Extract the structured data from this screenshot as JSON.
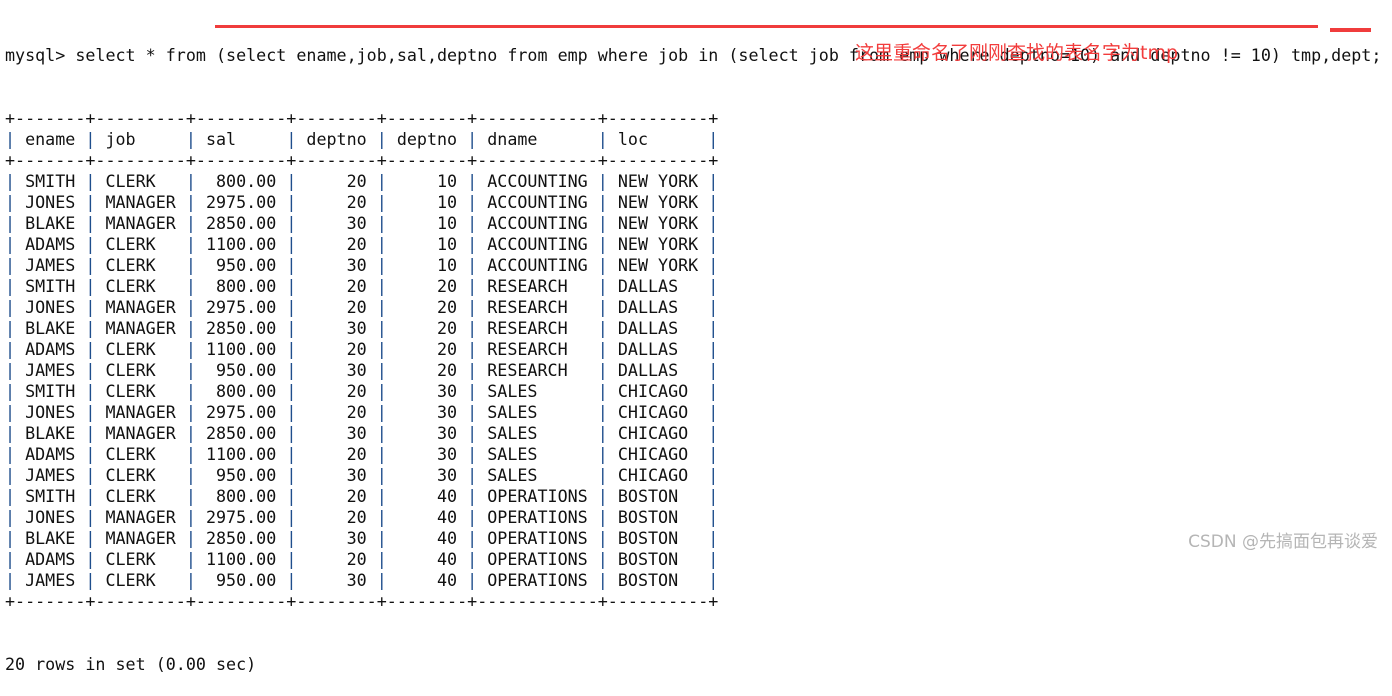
{
  "prompt": "mysql> ",
  "command": "select * from (select ename,job,sal,deptno from emp where job in (select job from emp where deptno=10) and deptno != 10) tmp,dept;",
  "annotation": "这里重命名了刚刚查找的表名字为tmp",
  "annotation_color": "#f23c3c",
  "table": {
    "columns": [
      "ename",
      "job",
      "sal",
      "deptno",
      "deptno",
      "dname",
      "loc"
    ],
    "rows": [
      [
        "SMITH",
        "CLERK",
        "800.00",
        "20",
        "10",
        "ACCOUNTING",
        "NEW YORK"
      ],
      [
        "JONES",
        "MANAGER",
        "2975.00",
        "20",
        "10",
        "ACCOUNTING",
        "NEW YORK"
      ],
      [
        "BLAKE",
        "MANAGER",
        "2850.00",
        "30",
        "10",
        "ACCOUNTING",
        "NEW YORK"
      ],
      [
        "ADAMS",
        "CLERK",
        "1100.00",
        "20",
        "10",
        "ACCOUNTING",
        "NEW YORK"
      ],
      [
        "JAMES",
        "CLERK",
        "950.00",
        "30",
        "10",
        "ACCOUNTING",
        "NEW YORK"
      ],
      [
        "SMITH",
        "CLERK",
        "800.00",
        "20",
        "20",
        "RESEARCH",
        "DALLAS"
      ],
      [
        "JONES",
        "MANAGER",
        "2975.00",
        "20",
        "20",
        "RESEARCH",
        "DALLAS"
      ],
      [
        "BLAKE",
        "MANAGER",
        "2850.00",
        "30",
        "20",
        "RESEARCH",
        "DALLAS"
      ],
      [
        "ADAMS",
        "CLERK",
        "1100.00",
        "20",
        "20",
        "RESEARCH",
        "DALLAS"
      ],
      [
        "JAMES",
        "CLERK",
        "950.00",
        "30",
        "20",
        "RESEARCH",
        "DALLAS"
      ],
      [
        "SMITH",
        "CLERK",
        "800.00",
        "20",
        "30",
        "SALES",
        "CHICAGO"
      ],
      [
        "JONES",
        "MANAGER",
        "2975.00",
        "20",
        "30",
        "SALES",
        "CHICAGO"
      ],
      [
        "BLAKE",
        "MANAGER",
        "2850.00",
        "30",
        "30",
        "SALES",
        "CHICAGO"
      ],
      [
        "ADAMS",
        "CLERK",
        "1100.00",
        "20",
        "30",
        "SALES",
        "CHICAGO"
      ],
      [
        "JAMES",
        "CLERK",
        "950.00",
        "30",
        "30",
        "SALES",
        "CHICAGO"
      ],
      [
        "SMITH",
        "CLERK",
        "800.00",
        "20",
        "40",
        "OPERATIONS",
        "BOSTON"
      ],
      [
        "JONES",
        "MANAGER",
        "2975.00",
        "20",
        "40",
        "OPERATIONS",
        "BOSTON"
      ],
      [
        "BLAKE",
        "MANAGER",
        "2850.00",
        "30",
        "40",
        "OPERATIONS",
        "BOSTON"
      ],
      [
        "ADAMS",
        "CLERK",
        "1100.00",
        "20",
        "40",
        "OPERATIONS",
        "BOSTON"
      ],
      [
        "JAMES",
        "CLERK",
        "950.00",
        "30",
        "40",
        "OPERATIONS",
        "BOSTON"
      ]
    ]
  },
  "footer": "20 rows in set (0.00 sec)",
  "watermark": "CSDN @先搞面包再谈爱"
}
